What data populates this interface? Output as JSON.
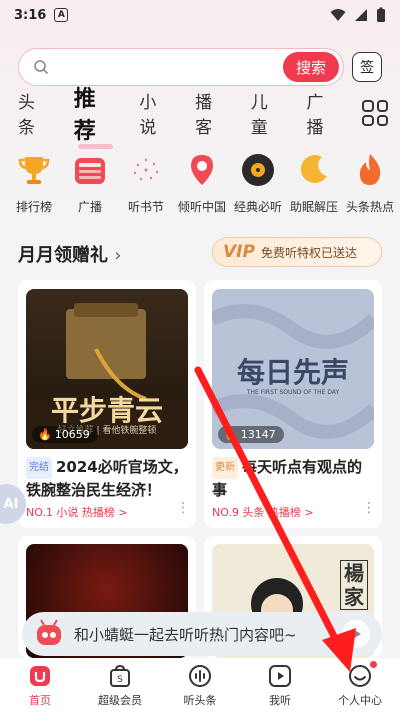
{
  "status": {
    "time": "3:16",
    "badge": "A"
  },
  "search": {
    "placeholder": "",
    "button": "搜索",
    "sign": "签"
  },
  "tabs": [
    "头条",
    "推荐",
    "小说",
    "播客",
    "儿童",
    "广播"
  ],
  "shortcuts": [
    "排行榜",
    "广播",
    "听书节",
    "倾听中国",
    "经典必听",
    "助眠解压",
    "头条热点"
  ],
  "promo": {
    "title": "月月领赠礼",
    "vip": "VIP",
    "vip_text": "免费听特权已送达"
  },
  "cards": [
    {
      "cover_text": "平步青云",
      "cover_sub": "好文推荐 | 看他铁腕整顿",
      "plays": "10659",
      "tag": "完结",
      "title": "2024必听官场文，铁腕整治民生经济！",
      "meta": "NO.1 小说 热播榜 >"
    },
    {
      "cover_text": "每日先声",
      "cover_sub": "THE FIRST SOUND OF THE DAY",
      "plays": "13147",
      "tag": "更新",
      "title": "每天听点有观点的事",
      "meta": "NO.9 头条 热播榜 >"
    }
  ],
  "lower_cards": [
    {
      "cover_text": ""
    },
    {
      "cover_text": "楊家"
    }
  ],
  "floating": {
    "label": "AI"
  },
  "toast": {
    "text": "和小蜻蜓一起去听听热门内容吧~"
  },
  "bottom_nav": [
    {
      "label": "首页",
      "icon": "home-icon"
    },
    {
      "label": "超级会员",
      "icon": "vip-bag-icon"
    },
    {
      "label": "听头条",
      "icon": "audio-wave-icon"
    },
    {
      "label": "我听",
      "icon": "play-square-icon"
    },
    {
      "label": "个人中心",
      "icon": "profile-icon"
    }
  ],
  "colors": {
    "accent": "#f03a4f",
    "vip_gold": "#d98b44",
    "annotation_arrow": "#ff1e1e"
  }
}
